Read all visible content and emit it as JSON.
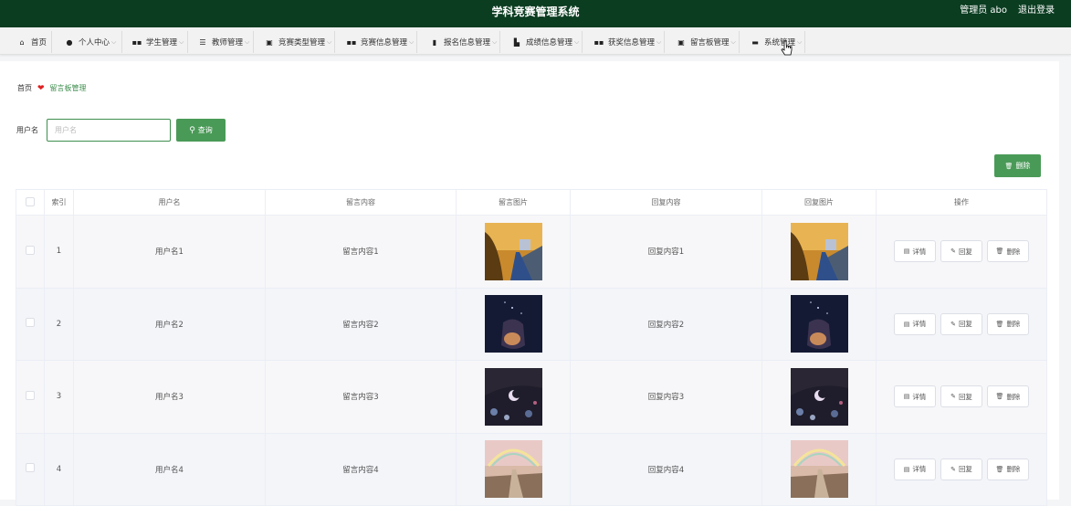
{
  "app": {
    "title": "学科竞赛管理系统",
    "user": "管理员 abo",
    "logout": "退出登录"
  },
  "nav": [
    {
      "label": "首页",
      "icon": "home-icon",
      "glyph": "⌂",
      "chevron": false
    },
    {
      "label": "个人中心",
      "icon": "person-icon",
      "glyph": "●",
      "chevron": true
    },
    {
      "label": "学生管理",
      "icon": "grid-icon",
      "glyph": "▪▪",
      "chevron": true
    },
    {
      "label": "教师管理",
      "icon": "sliders-icon",
      "glyph": "☰",
      "chevron": true
    },
    {
      "label": "竞赛类型管理",
      "icon": "clipboard-icon",
      "glyph": "▣",
      "chevron": true
    },
    {
      "label": "竞赛信息管理",
      "icon": "grid-icon",
      "glyph": "▪▪",
      "chevron": true
    },
    {
      "label": "报名信息管理",
      "icon": "bar-chart-icon",
      "glyph": "▮",
      "chevron": true
    },
    {
      "label": "成绩信息管理",
      "icon": "chart-icon",
      "glyph": "▙",
      "chevron": true
    },
    {
      "label": "获奖信息管理",
      "icon": "grid-icon",
      "glyph": "▪▪",
      "chevron": true
    },
    {
      "label": "留言板管理",
      "icon": "clipboard-icon",
      "glyph": "▣",
      "chevron": true
    },
    {
      "label": "系统管理",
      "icon": "message-icon",
      "glyph": "▬",
      "chevron": true
    }
  ],
  "breadcrumb": {
    "home": "首页",
    "current": "留言板管理"
  },
  "search": {
    "label": "用户名",
    "placeholder": "用户名",
    "button": "查询"
  },
  "toolbar": {
    "delete": "删除"
  },
  "table": {
    "headers": [
      "索引",
      "用户名",
      "留言内容",
      "留言图片",
      "回复内容",
      "回复图片",
      "操作"
    ],
    "rows": [
      {
        "index": "1",
        "username": "用户名1",
        "message": "留言内容1",
        "reply": "回复内容1",
        "image": "sunset-road"
      },
      {
        "index": "2",
        "username": "用户名2",
        "message": "留言内容2",
        "reply": "回复内容2",
        "image": "night-bottle"
      },
      {
        "index": "3",
        "username": "用户名3",
        "message": "留言内容3",
        "reply": "回复内容3",
        "image": "night-flowers"
      },
      {
        "index": "4",
        "username": "用户名4",
        "message": "留言内容4",
        "reply": "回复内容4",
        "image": "rainbow-path"
      }
    ],
    "actions": {
      "detail": "详情",
      "reply": "回复",
      "delete": "删除"
    }
  },
  "colors": {
    "topbar": "#0b3d21",
    "accent": "#4a9a57",
    "heart": "#e02020"
  }
}
